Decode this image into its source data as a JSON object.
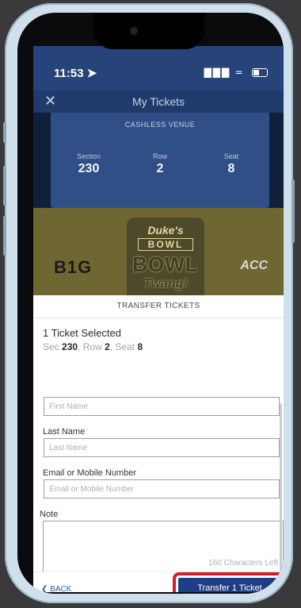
{
  "status_bar": {
    "time": "11:53",
    "signal": "▇▇▇",
    "wifi": "≃"
  },
  "header": {
    "title": "My Tickets",
    "close": "✕"
  },
  "ticket": {
    "venue": "CASHLESS VENUE",
    "section_label": "Section",
    "section": "230",
    "row_label": "Row",
    "row": "2",
    "seat_label": "Seat",
    "seat": "8"
  },
  "banner": {
    "left_logo": "B1G",
    "right_logo": "ACC",
    "event_line1": "Duke's",
    "event_line2": "BOWL",
    "event_line3": "BOWL",
    "event_line4": "Twang!"
  },
  "transfer_sheet": {
    "title": "TRANSFER TICKETS",
    "selected_text": "1 Ticket Selected",
    "sec_label": "Sec",
    "sec_value": "230",
    "row_label": "Row",
    "row_value": "2",
    "seat_label": "Seat",
    "seat_value": "8",
    "first_name_placeholder": "First Name",
    "last_name_label": "Last Name",
    "last_name_placeholder": "Last Name",
    "email_label": "Email or Mobile Number",
    "email_placeholder": "Email or Mobile Number",
    "note_label": "Note",
    "chars_left": "160 Characters Left"
  },
  "footer": {
    "back_label": "❮ BACK",
    "transfer_label": "Transfer 1 Ticket"
  },
  "colors": {
    "accent": "#1f3d85",
    "highlight": "#d21f2b"
  }
}
